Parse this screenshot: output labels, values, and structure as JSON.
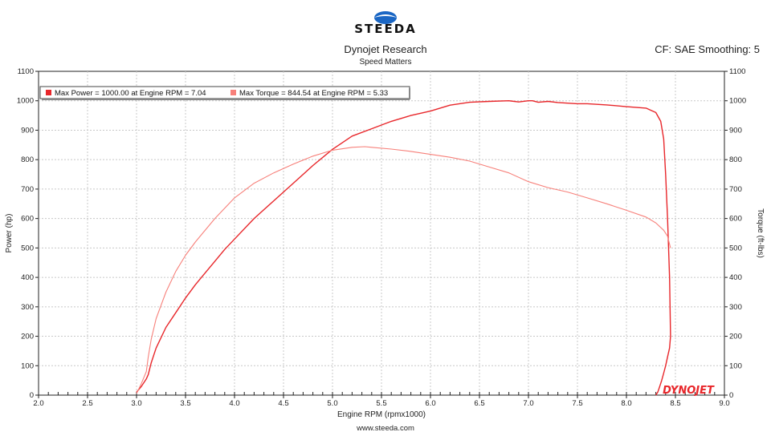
{
  "brand": {
    "logo_text": "STEEDA",
    "logo_color": "#1a66c4",
    "footer_logo": "DYNOJET"
  },
  "header": {
    "title": "Dynojet Research",
    "subtitle": "Speed Matters",
    "cf_label": "CF: SAE Smoothing: 5"
  },
  "footer": {
    "website": "www.steeda.com"
  },
  "colors": {
    "power": "#e8262a",
    "torque": "#f7807a",
    "axis": "#222222",
    "grid": "#c8c8c8"
  },
  "chart_data": {
    "type": "line",
    "xlabel": "Engine RPM (rpmx1000)",
    "ylabel_left": "Power (hp)",
    "ylabel_right": "Torque (ft-lbs)",
    "xlim": [
      2.0,
      9.0
    ],
    "ylim": [
      0,
      1100
    ],
    "xticks": [
      "2.0",
      "2.5",
      "3.0",
      "3.5",
      "4.0",
      "4.5",
      "5.0",
      "5.5",
      "6.0",
      "6.5",
      "7.0",
      "7.5",
      "8.0",
      "8.5",
      "9.0"
    ],
    "yticks": [
      "0",
      "100",
      "200",
      "300",
      "400",
      "500",
      "600",
      "700",
      "800",
      "900",
      "1000",
      "1100"
    ],
    "grid": true,
    "legend_position": "top-left",
    "series": [
      {
        "name": "Max Power = 1000.00 at Engine RPM = 7.04",
        "x": [
          3.0,
          3.05,
          3.1,
          3.12,
          3.15,
          3.2,
          3.3,
          3.4,
          3.5,
          3.6,
          3.7,
          3.8,
          3.9,
          4.0,
          4.2,
          4.4,
          4.6,
          4.8,
          5.0,
          5.2,
          5.4,
          5.6,
          5.8,
          6.0,
          6.2,
          6.4,
          6.6,
          6.8,
          6.9,
          7.0,
          7.04,
          7.1,
          7.2,
          7.3,
          7.4,
          7.5,
          7.6,
          7.8,
          8.0,
          8.2,
          8.3,
          8.35,
          8.38,
          8.4,
          8.42,
          8.44,
          8.45,
          8.44,
          8.42,
          8.4,
          8.38,
          8.36,
          8.34,
          8.32,
          8.3
        ],
        "y": [
          10,
          30,
          55,
          70,
          110,
          160,
          230,
          280,
          330,
          375,
          415,
          455,
          495,
          530,
          600,
          660,
          720,
          780,
          835,
          880,
          905,
          930,
          950,
          965,
          985,
          995,
          998,
          1000,
          996,
          1000,
          1000,
          995,
          998,
          994,
          992,
          990,
          990,
          986,
          980,
          975,
          960,
          930,
          870,
          750,
          600,
          400,
          200,
          160,
          130,
          100,
          75,
          50,
          30,
          10,
          0
        ]
      },
      {
        "name": "Max Torque = 844.54 at Engine RPM = 5.33",
        "x": [
          3.0,
          3.05,
          3.1,
          3.12,
          3.15,
          3.2,
          3.3,
          3.4,
          3.5,
          3.6,
          3.8,
          4.0,
          4.2,
          4.4,
          4.6,
          4.8,
          5.0,
          5.2,
          5.33,
          5.4,
          5.6,
          5.8,
          6.0,
          6.2,
          6.4,
          6.6,
          6.8,
          7.0,
          7.2,
          7.4,
          7.6,
          7.8,
          8.0,
          8.2,
          8.3,
          8.38,
          8.42,
          8.45
        ],
        "y": [
          5,
          40,
          80,
          130,
          190,
          260,
          350,
          420,
          475,
          520,
          600,
          670,
          720,
          755,
          785,
          812,
          832,
          842,
          844,
          842,
          836,
          828,
          818,
          808,
          795,
          775,
          755,
          725,
          705,
          690,
          670,
          650,
          628,
          605,
          585,
          560,
          540,
          500
        ]
      }
    ]
  }
}
